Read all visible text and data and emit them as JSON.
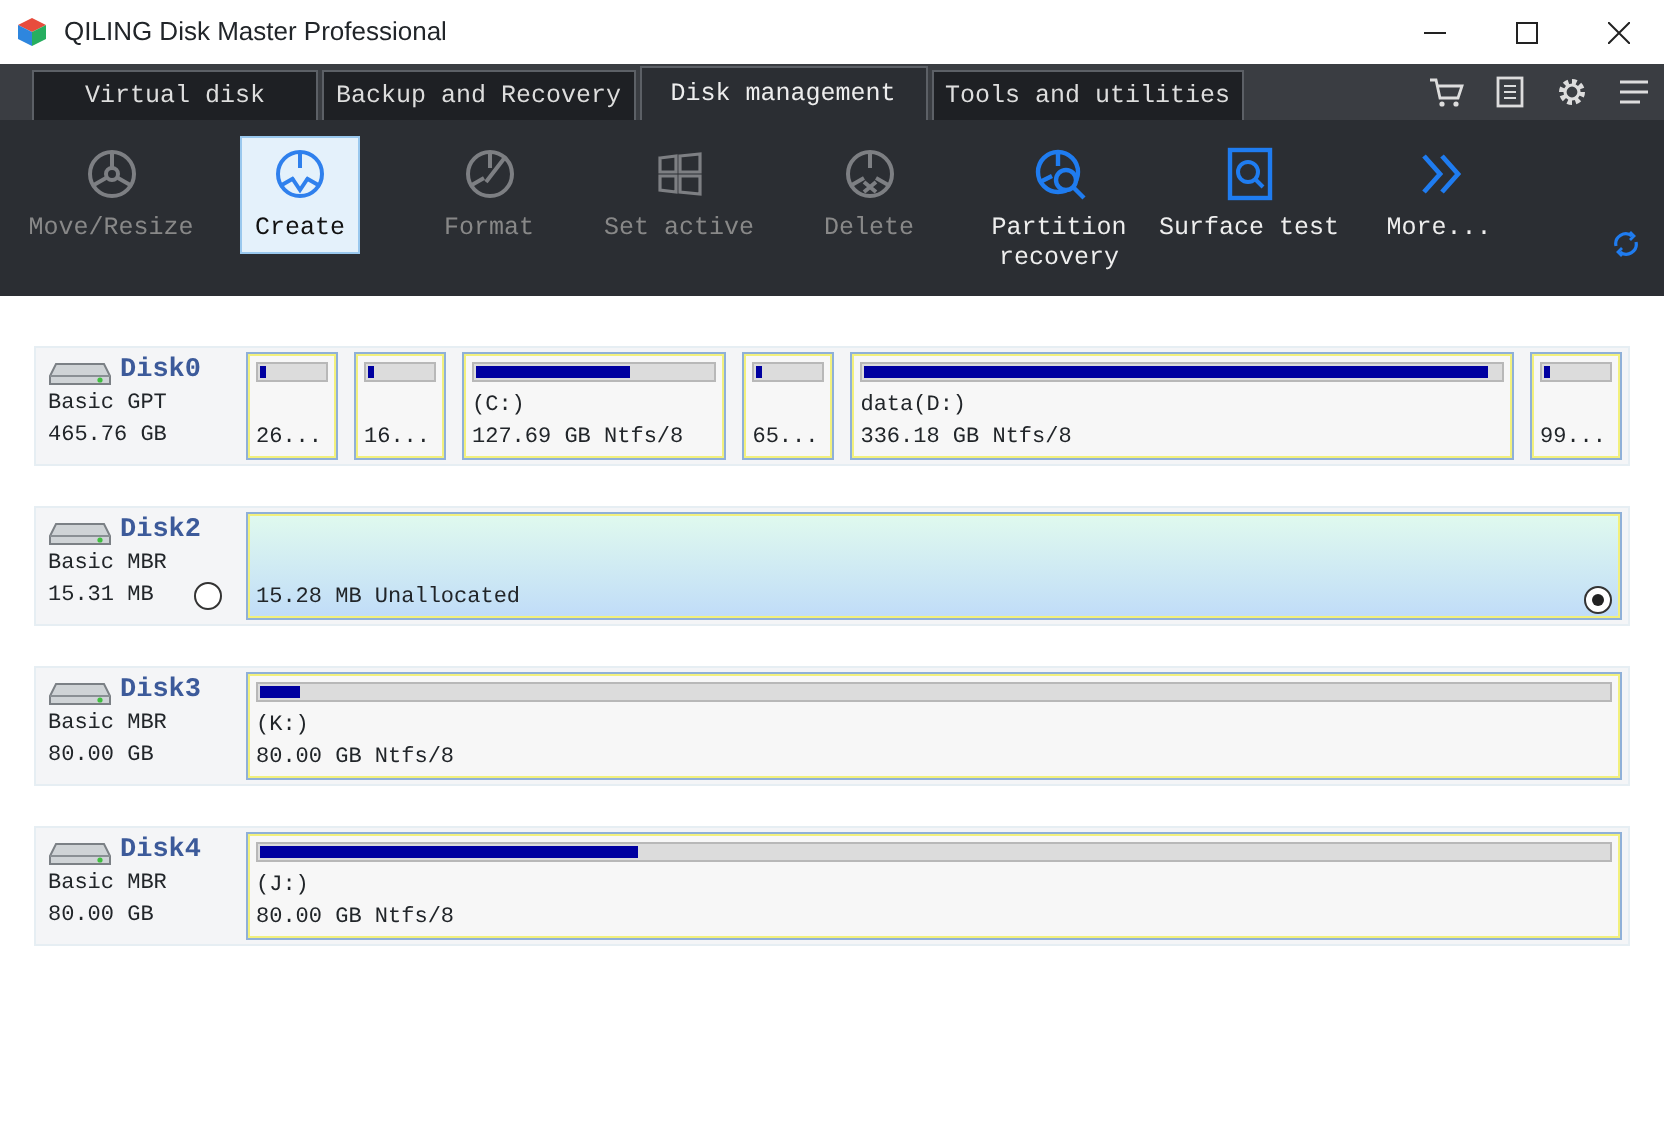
{
  "window": {
    "title": "QILING Disk Master Professional"
  },
  "tabs": [
    {
      "label": "Virtual disk",
      "selected": false
    },
    {
      "label": "Backup and Recovery",
      "selected": false
    },
    {
      "label": "Disk management",
      "selected": true
    },
    {
      "label": "Tools and utilities",
      "selected": false
    }
  ],
  "toolbar": [
    {
      "label": "Move/Resize",
      "kind": "resize",
      "disabled": true,
      "selected": false
    },
    {
      "label": "Create",
      "kind": "create",
      "disabled": false,
      "selected": true
    },
    {
      "label": "Format",
      "kind": "format",
      "disabled": true,
      "selected": false
    },
    {
      "label": "Set active",
      "kind": "windows",
      "disabled": true,
      "selected": false
    },
    {
      "label": "Delete",
      "kind": "delete",
      "disabled": true,
      "selected": false
    },
    {
      "label": "Partition recovery",
      "kind": "recovery",
      "disabled": false,
      "selected": false
    },
    {
      "label": "Surface test",
      "kind": "surface",
      "disabled": false,
      "selected": false
    },
    {
      "label": "More...",
      "kind": "more",
      "disabled": false,
      "selected": false
    }
  ],
  "disks": [
    {
      "name": "Disk0",
      "type": "Basic GPT",
      "size": "465.76 GB",
      "partitions": [
        {
          "kind": "compact",
          "info": "26...",
          "level": 0.1,
          "selected": false
        },
        {
          "kind": "compact",
          "info": "16...",
          "level": 0.1,
          "selected": false
        },
        {
          "kind": "wide",
          "label": "(C:)",
          "info": "127.69 GB Ntfs/8",
          "level": 0.65,
          "selected": false
        },
        {
          "kind": "compact",
          "info": "65...",
          "level": 0.1,
          "selected": false
        },
        {
          "kind": "wide",
          "label": "data(D:)",
          "info": "336.18 GB Ntfs/8",
          "level": 0.98,
          "selected": false
        },
        {
          "kind": "compact",
          "info": "99...",
          "level": 0.1,
          "selected": false
        }
      ]
    },
    {
      "name": "Disk2",
      "type": "Basic MBR",
      "size": "15.31 MB",
      "selected": false,
      "partitions": [
        {
          "kind": "unallocated",
          "info": "15.28 MB Unallocated",
          "selected": true
        }
      ]
    },
    {
      "name": "Disk3",
      "type": "Basic MBR",
      "size": "80.00 GB",
      "partitions": [
        {
          "kind": "wide",
          "label": "(K:)",
          "info": "80.00 GB Ntfs/8",
          "level": 0.03,
          "selected": false
        }
      ]
    },
    {
      "name": "Disk4",
      "type": "Basic MBR",
      "size": "80.00 GB",
      "partitions": [
        {
          "kind": "wide",
          "label": "(J:)",
          "info": "80.00 GB Ntfs/8",
          "level": 0.28,
          "selected": false
        }
      ]
    }
  ]
}
